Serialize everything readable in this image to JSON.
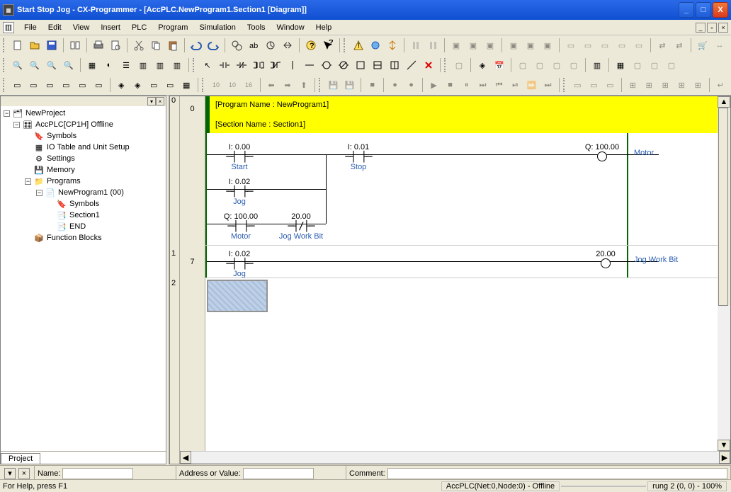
{
  "title": "Start Stop Jog - CX-Programmer - [AccPLC.NewProgram1.Section1 [Diagram]]",
  "menus": [
    "File",
    "Edit",
    "View",
    "Insert",
    "PLC",
    "Program",
    "Simulation",
    "Tools",
    "Window",
    "Help"
  ],
  "sidebar": {
    "tab": "Project",
    "root": "NewProject",
    "plc": "AccPLC[CP1H] Offline",
    "items": {
      "symbols": "Symbols",
      "iotable": "IO Table and Unit Setup",
      "settings": "Settings",
      "memory": "Memory",
      "programs": "Programs",
      "newprogram": "NewProgram1 (00)",
      "prog_symbols": "Symbols",
      "section1": "Section1",
      "end": "END",
      "fblocks": "Function Blocks"
    }
  },
  "ladder": {
    "program_name_label": "[Program Name : NewProgram1]",
    "section_name_label": "[Section Name : Section1]",
    "rungs_left": [
      "0",
      "1",
      "2"
    ],
    "step_nums": [
      "0",
      "7"
    ],
    "contacts": {
      "start": {
        "addr": "I: 0.00",
        "label": "Start"
      },
      "stop": {
        "addr": "I: 0.01",
        "label": "Stop"
      },
      "jog1": {
        "addr": "I: 0.02",
        "label": "Jog"
      },
      "motor_contact": {
        "addr": "Q: 100.00",
        "label": "Motor"
      },
      "jogwb_contact": {
        "addr": "20.00",
        "label": "Jog Work Bit"
      },
      "motor_coil": {
        "addr": "Q: 100.00",
        "label": "Motor"
      },
      "jog2": {
        "addr": "I: 0.02",
        "label": "Jog"
      },
      "jogwb_coil": {
        "addr": "20.00",
        "label": "Jog Work Bit"
      }
    }
  },
  "bottom": {
    "name_label": "Name:",
    "addr_label": "Address or Value:",
    "comment_label": "Comment:"
  },
  "status": {
    "help": "For Help, press F1",
    "plc": "AccPLC(Net:0,Node:0) - Offline",
    "rung": "rung 2 (0, 0) - 100%"
  }
}
